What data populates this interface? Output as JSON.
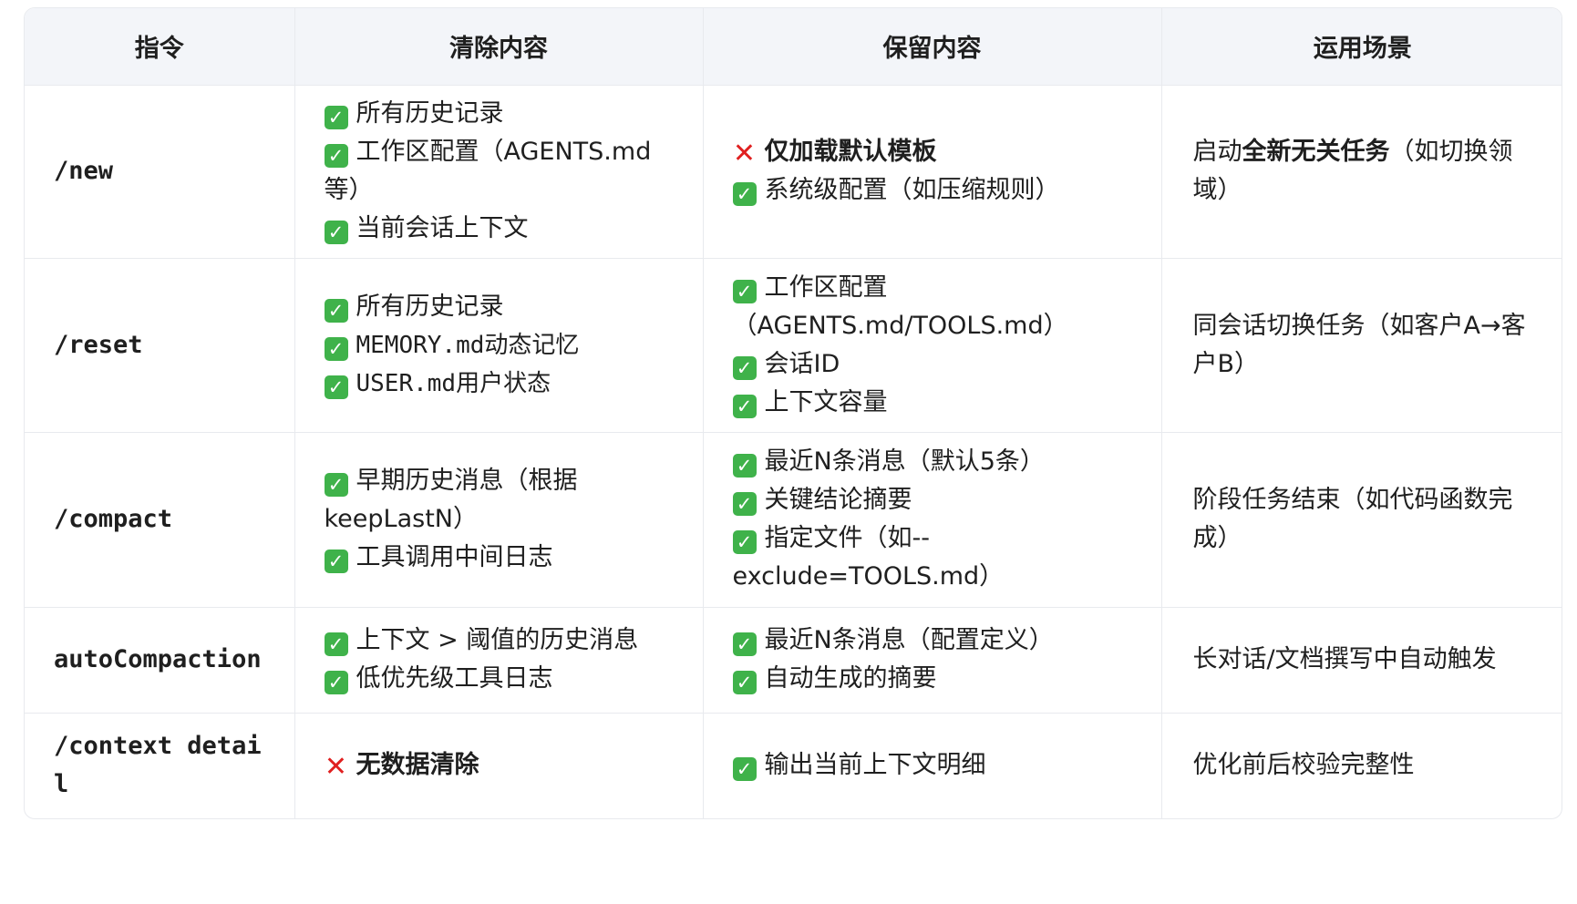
{
  "header": {
    "col_command": "指令",
    "col_clear": "清除内容",
    "col_keep": "保留内容",
    "col_scene": "运用场景"
  },
  "icons": {
    "check": "✓",
    "cross": "✕",
    "check_color": "#3fb24a",
    "cross_color": "#e02020"
  },
  "rows": [
    {
      "command": "/new",
      "clear": [
        "所有历史记录",
        "工作区配置（AGENTS.md等）",
        "当前会话上下文"
      ],
      "keep_cross": "仅加载默认模板",
      "keep": [
        "系统级配置（如压缩规则）"
      ],
      "scene_pre": "启动",
      "scene_bold": "全新无关任务",
      "scene_post": "（如切换领域）"
    },
    {
      "command": "/reset",
      "clear": [
        "所有历史记录",
        "MEMORY.md动态记忆",
        "USER.md用户状态"
      ],
      "keep": [
        "工作区配置（AGENTS.md/TOOLS.md）",
        "会话ID",
        "上下文容量"
      ],
      "scene": "同会话切换任务（如客户A→客户B）"
    },
    {
      "command": "/compact",
      "clear": [
        "早期历史消息（根据keepLastN）",
        "工具调用中间日志"
      ],
      "keep": [
        "最近N条消息（默认5条）",
        "关键结论摘要",
        "指定文件（如--exclude=TOOLS.md）"
      ],
      "scene": "阶段任务结束（如代码函数完成）"
    },
    {
      "command": "autoCompaction",
      "clear": [
        "上下文 > 阈值的历史消息",
        "低优先级工具日志"
      ],
      "keep": [
        "最近N条消息（配置定义）",
        "自动生成的摘要"
      ],
      "scene": "长对话/文档撰写中自动触发"
    },
    {
      "command": "/context detail",
      "clear_cross": "无数据清除",
      "keep": [
        "输出当前上下文明细"
      ],
      "scene": "优化前后校验完整性"
    }
  ]
}
